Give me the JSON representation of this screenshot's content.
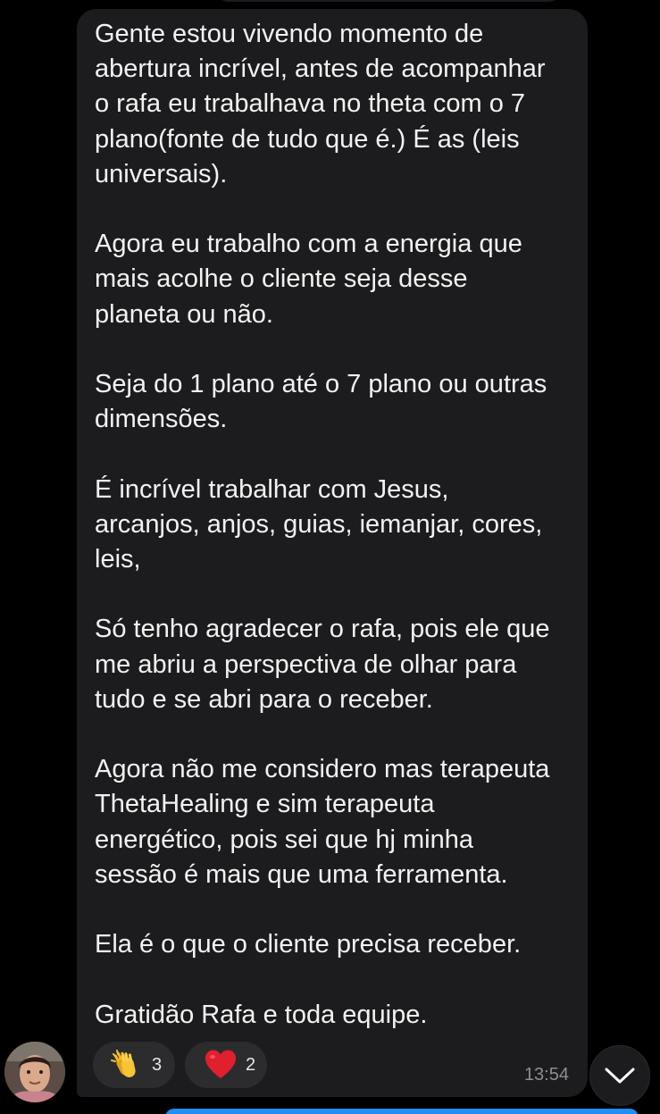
{
  "message": {
    "paragraphs": [
      "Gente estou vivendo momento de\nabertura incrível, antes de acompanhar\no rafa eu trabalhava no theta com o 7\nplano(fonte de tudo que é.) É as (leis\nuniversais).",
      "Agora eu trabalho com a energia que\nmais acolhe o cliente seja desse\nplaneta ou não.",
      "Seja do 1 plano até o 7 plano ou outras\ndimensões.",
      "É incrível trabalhar com Jesus,\narcanjos, anjos, guias, iemanjar, cores,\nleis,",
      "Só tenho agradecer o rafa, pois ele que\nme abriu a perspectiva de olhar para\ntudo e se abri para o receber.",
      "Agora não me considero mas terapeuta\nThetaHealing e sim terapeuta\nenergético, pois sei que hj minha\nsessão é mais que uma ferramenta.",
      "Ela é o que o cliente precisa receber.",
      "Gratidão Rafa e toda equipe."
    ],
    "timestamp": "13:54"
  },
  "reactions": [
    {
      "icon": "clapping-hands-icon",
      "count": "3"
    },
    {
      "icon": "red-heart-icon",
      "count": "2"
    }
  ],
  "colors": {
    "background": "#000000",
    "bubble": "#1c1c1e",
    "text": "#f2f2f2",
    "reaction_pill": "#2c2c2e",
    "timestamp": "#8e8e93",
    "accent_blue": "#1d8ff5",
    "heart": "#e0202e"
  }
}
